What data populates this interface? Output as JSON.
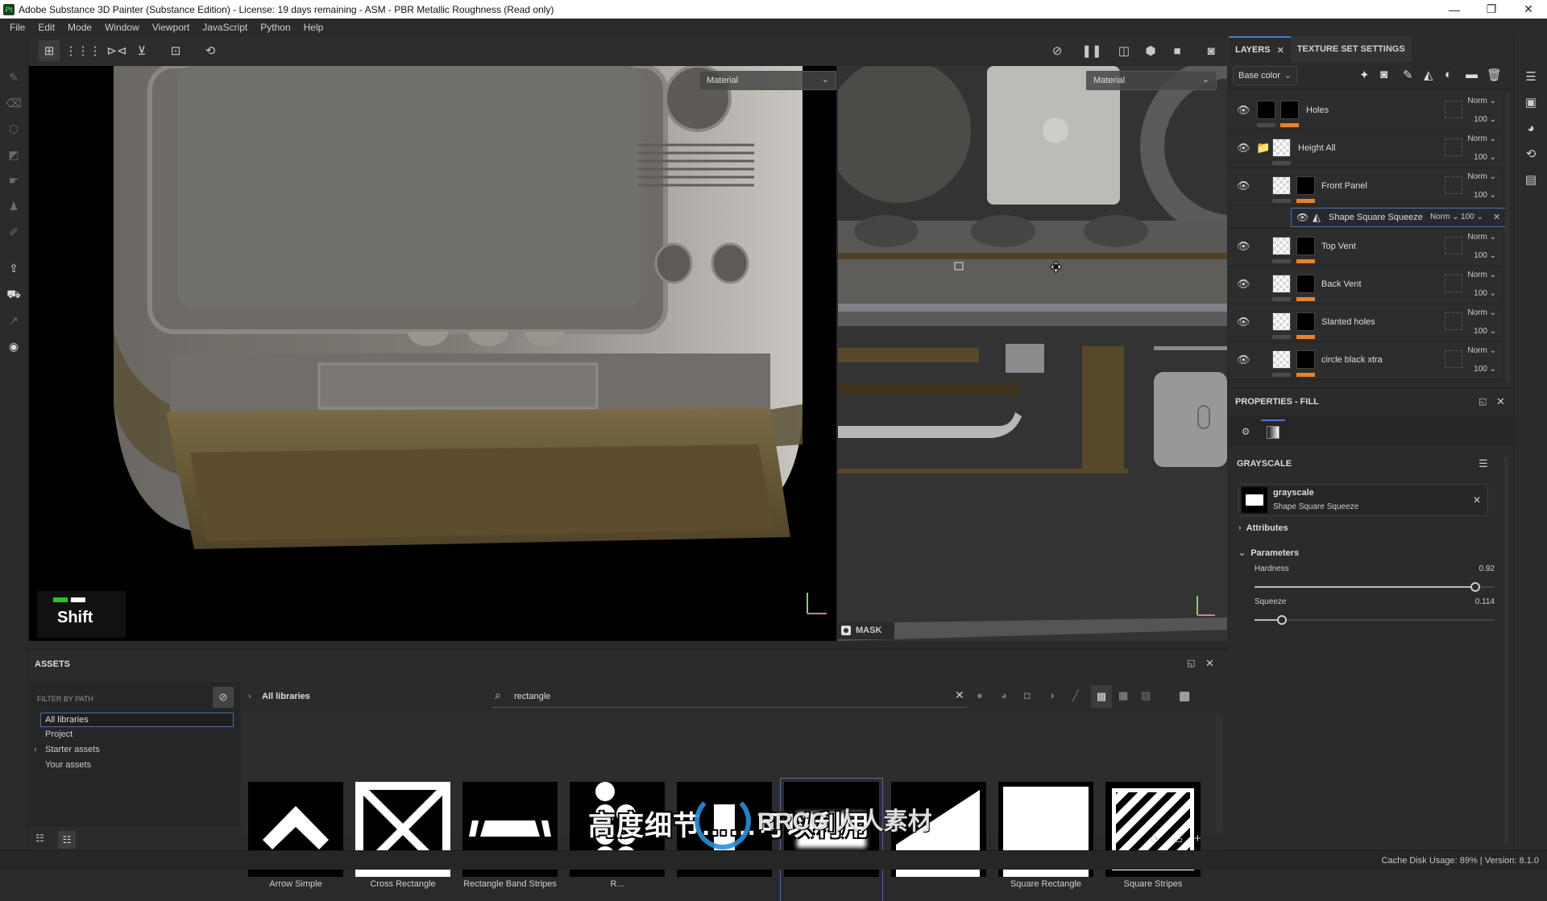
{
  "window": {
    "title": "Adobe Substance 3D Painter (Substance Edition) - License: 19 days remaining - ASM - PBR Metallic Roughness (Read only)",
    "app_icon": "Pt",
    "controls": {
      "minimize": "—",
      "maximize": "❐",
      "close": "✕"
    }
  },
  "menu": [
    "File",
    "Edit",
    "Mode",
    "Window",
    "Viewport",
    "JavaScript",
    "Python",
    "Help"
  ],
  "toolbar": {
    "left_icons": [
      "select-object-icon",
      "uv-grid-icon",
      "mirror-x-icon",
      "mirror-y-icon",
      "add-anchor-icon",
      "reset-icon"
    ],
    "right_icons": [
      "hide-selection-icon",
      "pause-icon",
      "split-view-icon",
      "3d-view-icon",
      "camera-icon",
      "screenshot-icon"
    ]
  },
  "viewport3d": {
    "channel_dropdown": "Material",
    "key_overlay": "Shift",
    "key_overlay_colors": [
      "#2fc12f",
      "#ffffff"
    ]
  },
  "viewport2d": {
    "channel_dropdown": "Material",
    "mask_label": "MASK"
  },
  "layers_panel": {
    "tab_active": "LAYERS",
    "tab_other": "TEXTURE SET SETTINGS",
    "channel": "Base color",
    "accent": "#e8832d",
    "layers": [
      {
        "name": "Holes",
        "blend": "Norm",
        "opacity": "100",
        "type": "fill",
        "folder": false,
        "indent": 0
      },
      {
        "name": "Height All",
        "blend": "Norm",
        "opacity": "100",
        "type": "folder",
        "folder": true,
        "indent": 0
      },
      {
        "name": "Front Panel",
        "blend": "Norm",
        "opacity": "100",
        "type": "layer",
        "folder": false,
        "indent": 1
      },
      {
        "name": "Top Vent",
        "blend": "Norm",
        "opacity": "100",
        "type": "layer",
        "folder": false,
        "indent": 1
      },
      {
        "name": "Back Vent",
        "blend": "Norm",
        "opacity": "100",
        "type": "layer",
        "folder": false,
        "indent": 1
      },
      {
        "name": "Slanted holes",
        "blend": "Norm",
        "opacity": "100",
        "type": "layer",
        "folder": false,
        "indent": 1
      },
      {
        "name": "circle black xtra",
        "blend": "Norm",
        "opacity": "100",
        "type": "layer",
        "folder": false,
        "indent": 1
      }
    ],
    "effect": {
      "name": "Shape Square Squeeze",
      "blend": "Norm",
      "opacity": "100"
    }
  },
  "properties_panel": {
    "title": "PROPERTIES - FILL",
    "section": "GRAYSCALE",
    "resource": {
      "name": "grayscale",
      "source": "Shape Square Squeeze"
    },
    "attributes_label": "Attributes",
    "parameters_label": "Parameters",
    "params": [
      {
        "label": "Hardness",
        "value": "0.92",
        "fraction": 0.92
      },
      {
        "label": "Squeeze",
        "value": "0.114",
        "fraction": 0.114
      }
    ]
  },
  "assets_panel": {
    "title": "ASSETS",
    "filter_label": "FILTER BY PATH",
    "tree": [
      {
        "label": "All libraries",
        "selected": true,
        "expandable": false
      },
      {
        "label": "Project",
        "selected": false,
        "expandable": false
      },
      {
        "label": "Starter assets",
        "selected": false,
        "expandable": true
      },
      {
        "label": "Your assets",
        "selected": false,
        "expandable": false
      }
    ],
    "breadcrumb": "All libraries",
    "search_value": "rectangle",
    "items": [
      {
        "name": "Arrow Simple",
        "shape": "arrow"
      },
      {
        "name": "Cross Rectangle",
        "shape": "cross"
      },
      {
        "name": "Rectangle Band Stripes",
        "shape": "band"
      },
      {
        "name": "R...",
        "shape": "dots"
      },
      {
        "name": "",
        "shape": "pill"
      },
      {
        "name": "",
        "shape": "soft-rect",
        "selected": true
      },
      {
        "name": "",
        "shape": "wedge"
      },
      {
        "name": "Square Rectangle",
        "shape": "square"
      },
      {
        "name": "Square Stripes",
        "shape": "stripes"
      }
    ]
  },
  "status": {
    "text": "Cache Disk Usage:   89% | Version: 8.1.0"
  },
  "overlay": {
    "subtitle": "高度细节……可以利用",
    "watermark": "RRCG 人人素材"
  }
}
